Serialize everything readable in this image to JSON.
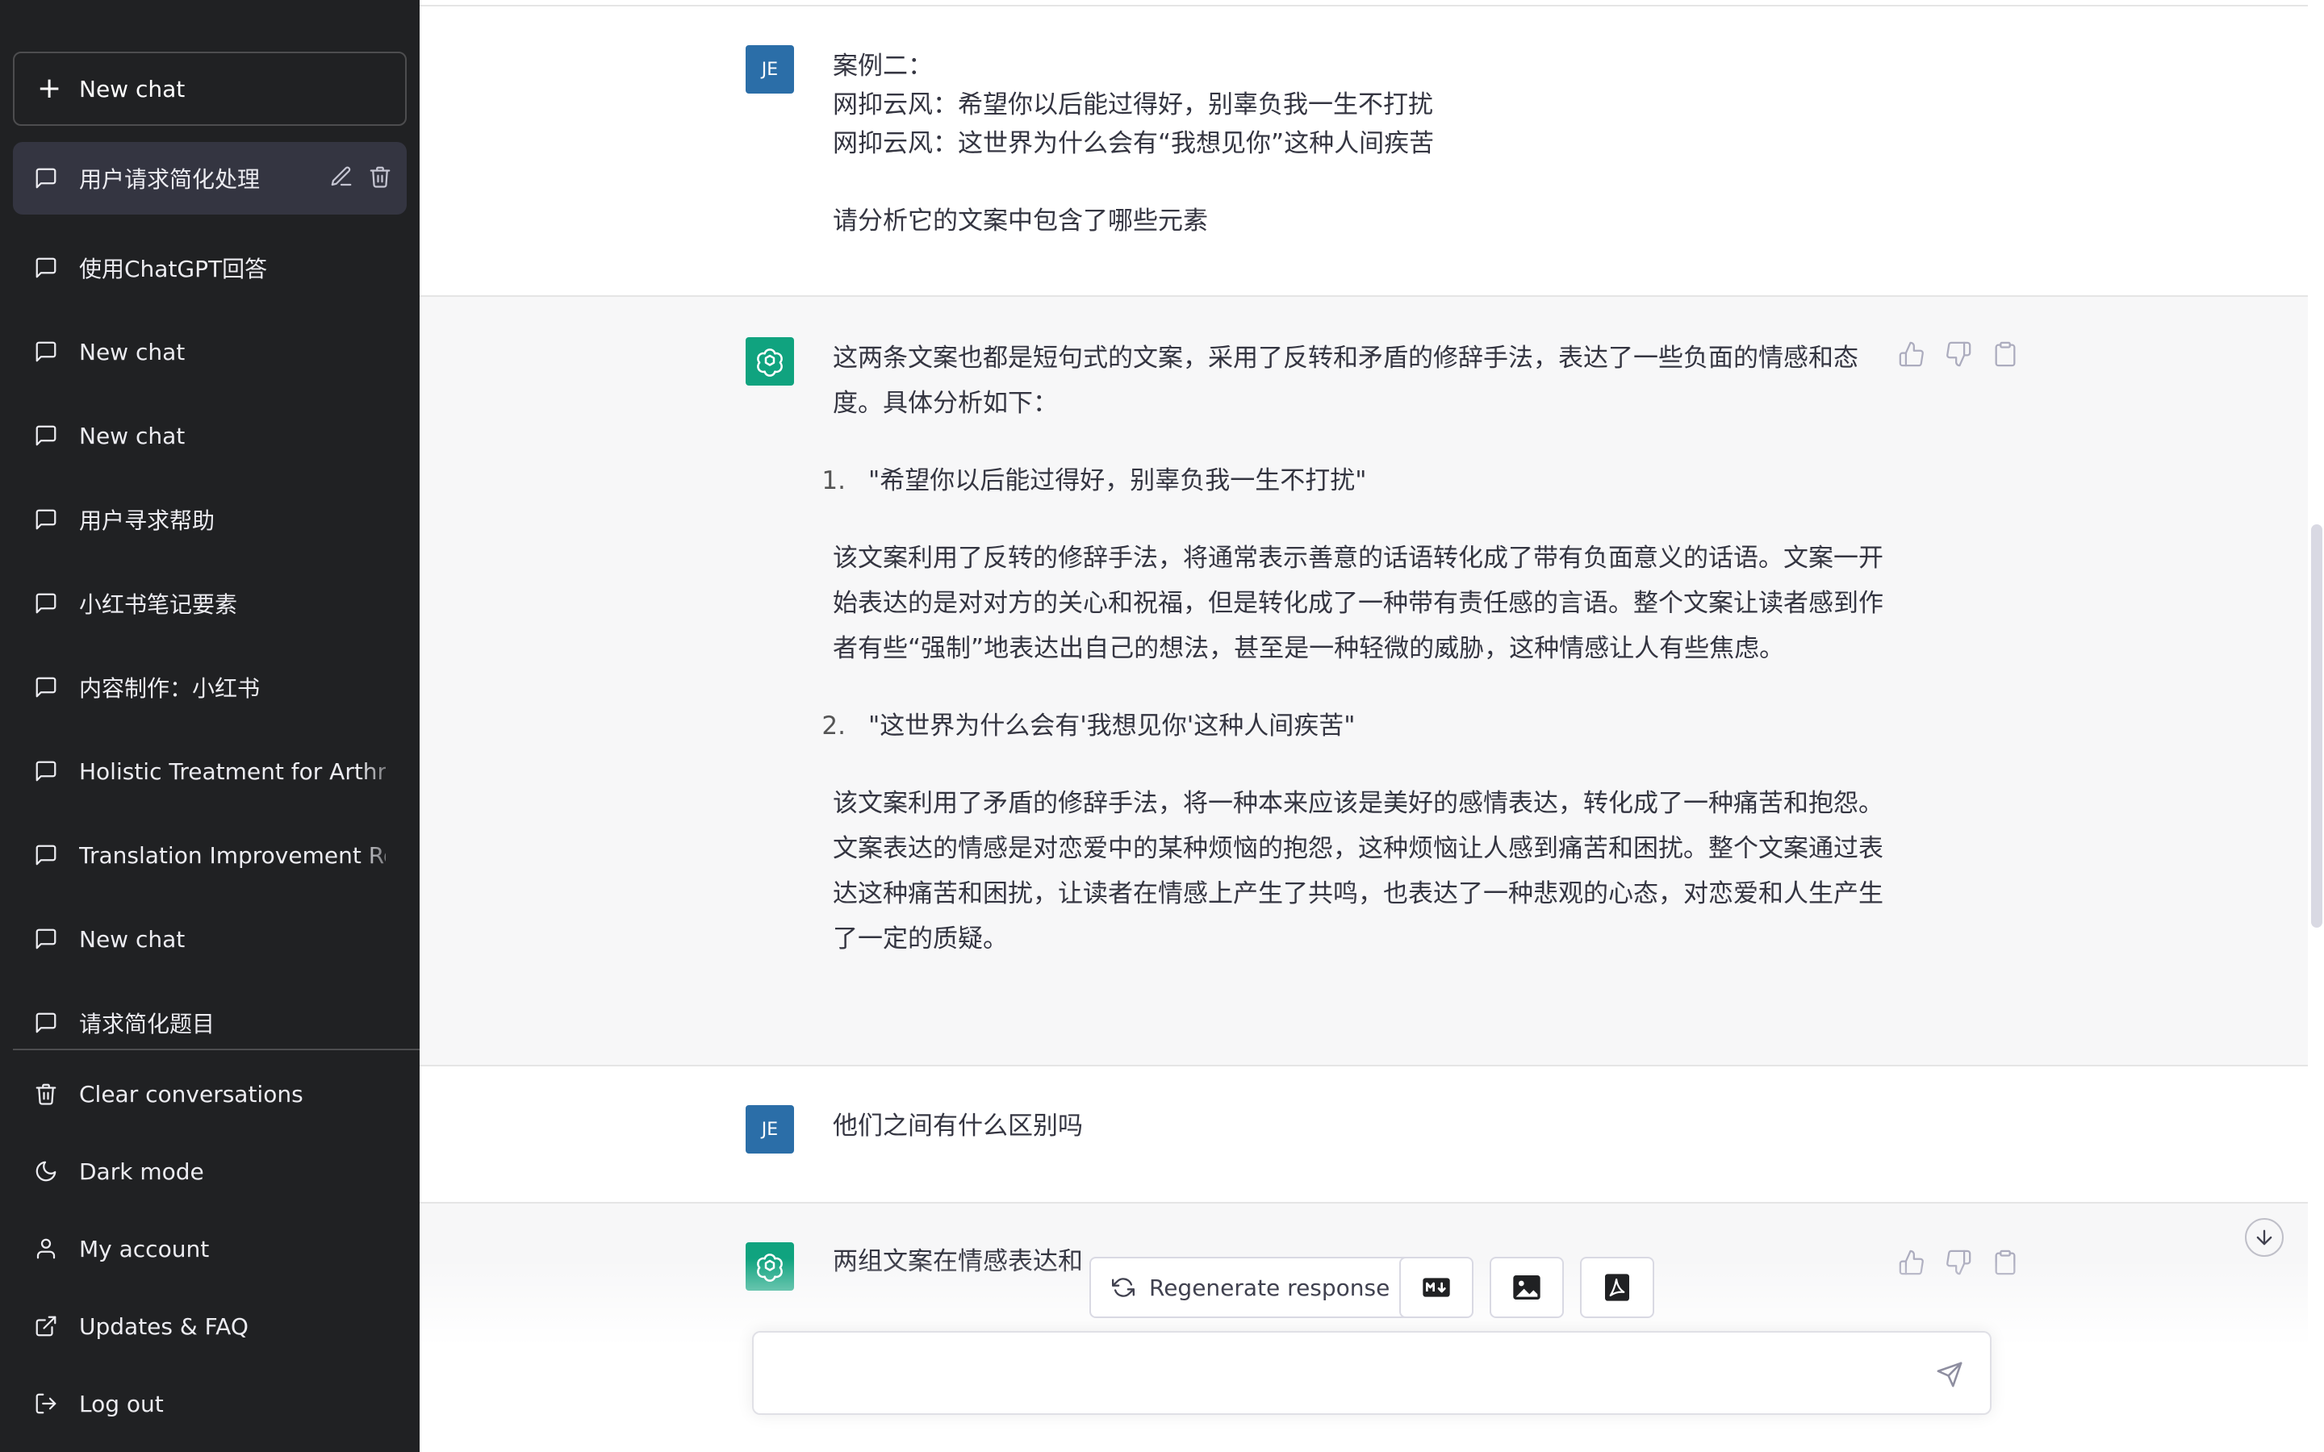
{
  "sidebar": {
    "new_chat_label": "New chat",
    "conversations": [
      {
        "label": "用户请求简化处理",
        "active": true
      },
      {
        "label": "使用ChatGPT回答"
      },
      {
        "label": "New chat"
      },
      {
        "label": "New chat"
      },
      {
        "label": "用户寻求帮助"
      },
      {
        "label": "小红书笔记要素"
      },
      {
        "label": "内容制作：小红书"
      },
      {
        "label": "Holistic Treatment for Arthritis"
      },
      {
        "label": "Translation Improvement Request"
      },
      {
        "label": "New chat"
      },
      {
        "label": "请求简化题目"
      }
    ],
    "menu": {
      "clear": "Clear conversations",
      "dark_mode": "Dark mode",
      "account": "My account",
      "updates": "Updates & FAQ",
      "logout": "Log out"
    }
  },
  "messages": {
    "user1": {
      "avatar": "JE",
      "lines": [
        "案例二：",
        "网抑云风：希望你以后能过得好，别辜负我一生不打扰",
        "网抑云风：这世界为什么会有“我想见你”这种人间疾苦",
        "",
        "请分析它的文案中包含了哪些元素"
      ]
    },
    "bot1": {
      "intro": "这两条文案也都是短句式的文案，采用了反转和矛盾的修辞手法，表达了一些负面的情感和态度。具体分析如下：",
      "item1_num": "1.",
      "item1_text": "\"希望你以后能过得好，别辜负我一生不打扰\"",
      "item1_para": "该文案利用了反转的修辞手法，将通常表示善意的话语转化成了带有负面意义的话语。文案一开始表达的是对对方的关心和祝福，但是转化成了一种带有责任感的言语。整个文案让读者感到作者有些“强制”地表达出自己的想法，甚至是一种轻微的威胁，这种情感让人有些焦虑。",
      "item2_num": "2.",
      "item2_text": "\"这世界为什么会有'我想见你'这种人间疾苦\"",
      "item2_para": "该文案利用了矛盾的修辞手法，将一种本来应该是美好的感情表达，转化成了一种痛苦和抱怨。文案表达的情感是对恋爱中的某种烦恼的抱怨，这种烦恼让人感到痛苦和困扰。整个文案通过表达这种痛苦和困扰，让读者在情感上产生了共鸣，也表达了一种悲观的心态，对恋爱和人生产生了一定的质疑。"
    },
    "user2": {
      "avatar": "JE",
      "text": "他们之间有什么区别吗"
    },
    "bot2": {
      "text": "两组文案在情感表达和"
    }
  },
  "toolbar": {
    "regenerate": "Regenerate response",
    "markdown_icon": "markdown-icon",
    "image_icon": "image-icon",
    "pdf_icon": "pdf-icon"
  },
  "composer": {
    "placeholder": ""
  },
  "colors": {
    "sidebar_bg": "#202123",
    "accent": "#10a37f",
    "user_avatar": "#2b6ea8",
    "bot_bg": "#f7f7f8"
  }
}
